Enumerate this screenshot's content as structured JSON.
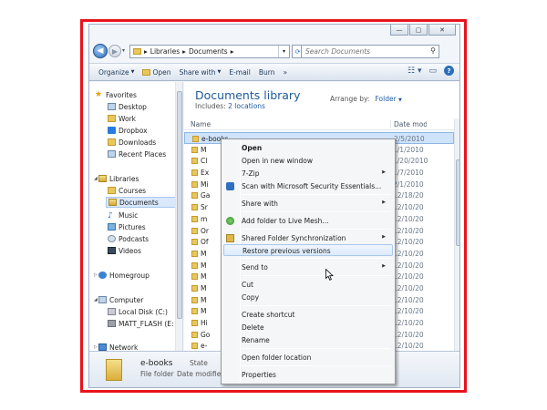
{
  "address": {
    "crumbs": [
      "Libraries",
      "Documents"
    ]
  },
  "search": {
    "placeholder": "Search Documents"
  },
  "toolbar": {
    "organize": "Organize",
    "open": "Open",
    "share_with": "Share with",
    "email": "E-mail",
    "burn": "Burn",
    "more": "»"
  },
  "sidebar": {
    "favorites": "Favorites",
    "desktop": "Desktop",
    "work": "Work",
    "dropbox": "Dropbox",
    "downloads": "Downloads",
    "recent": "Recent Places",
    "libraries": "Libraries",
    "courses": "Courses",
    "documents": "Documents",
    "music": "Music",
    "pictures": "Pictures",
    "podcasts": "Podcasts",
    "videos": "Videos",
    "homegroup": "Homegroup",
    "computer": "Computer",
    "local_disk": "Local Disk (C:)",
    "matt_flash": "MATT_FLASH (E:",
    "network": "Network"
  },
  "main": {
    "title": "Documents library",
    "includes_label": "Includes:",
    "includes_link": "2 locations",
    "arrange_label": "Arrange by:",
    "arrange_value": "Folder",
    "col_name": "Name",
    "col_date": "Date mod"
  },
  "rows": [
    {
      "name": "e-books",
      "date": "2/5/2010"
    },
    {
      "name": "M",
      "date": "1/1/2010"
    },
    {
      "name": "Cl",
      "date": "1/20/2010"
    },
    {
      "name": "Ex",
      "date": "1/7/2010"
    },
    {
      "name": "Mi",
      "date": "2/1/2010"
    },
    {
      "name": "Ga",
      "date": "12/18/20"
    },
    {
      "name": "Sr",
      "date": "12/10/20"
    },
    {
      "name": "m",
      "date": "12/10/20"
    },
    {
      "name": "Or",
      "date": "12/10/20"
    },
    {
      "name": "Of",
      "date": "12/10/20"
    },
    {
      "name": "M",
      "date": "12/10/20"
    },
    {
      "name": "M",
      "date": "12/10/20"
    },
    {
      "name": "M",
      "date": "12/10/20"
    },
    {
      "name": "M",
      "date": "12/10/20"
    },
    {
      "name": "M",
      "date": "12/10/20"
    },
    {
      "name": "M",
      "date": "12/10/20"
    },
    {
      "name": "Hi",
      "date": "12/10/20"
    },
    {
      "name": "Go",
      "date": "12/10/20"
    },
    {
      "name": "e-",
      "date": "12/10/20"
    }
  ],
  "status": {
    "name": "e-books",
    "type": "File folder",
    "state": "State",
    "date_modified": "Date modified"
  },
  "context_menu": {
    "open": "Open",
    "open_new_window": "Open in new window",
    "zip": "7-Zip",
    "scan": "Scan with Microsoft Security Essentials...",
    "share_with": "Share with",
    "add_live_mesh": "Add folder to Live Mesh...",
    "shared_sync": "Shared Folder Synchronization",
    "restore": "Restore previous versions",
    "send_to": "Send to",
    "cut": "Cut",
    "copy": "Copy",
    "create_shortcut": "Create shortcut",
    "delete": "Delete",
    "rename": "Rename",
    "open_location": "Open folder location",
    "properties": "Properties"
  }
}
